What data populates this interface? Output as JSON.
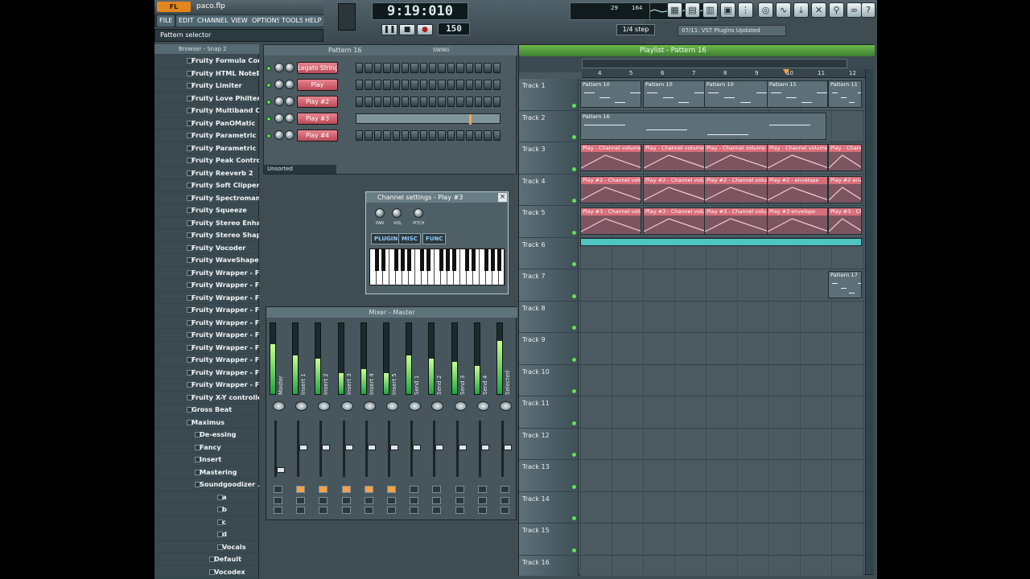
{
  "app": {
    "logo": "FL STUDIO",
    "project": "paco.flp"
  },
  "menu": [
    "FILE",
    "EDIT",
    "CHANNELS",
    "VIEW",
    "OPTIONS",
    "TOOLS",
    "HELP"
  ],
  "pattern_selector": "Pattern selector",
  "transport": {
    "time": "9:19:010",
    "tempo": "150",
    "play": "▶",
    "stop": "■",
    "record": "●",
    "pause": "❚❚",
    "step": "1/4 step",
    "hint": "07/11: VST Plugins Updated",
    "cpu": "29",
    "poly": "164"
  },
  "browser": {
    "title": "Browser - Snap 2",
    "items": [
      {
        "label": "Fruity Formula Con...",
        "indent": 0
      },
      {
        "label": "Fruity HTML NoteB...",
        "indent": 0
      },
      {
        "label": "Fruity Limiter",
        "indent": 0
      },
      {
        "label": "Fruity Love Philter",
        "indent": 0
      },
      {
        "label": "Fruity Multiband Co...",
        "indent": 0
      },
      {
        "label": "Fruity PanOMatic",
        "indent": 0
      },
      {
        "label": "Fruity Parametric EQ",
        "indent": 0
      },
      {
        "label": "Fruity Parametric E...",
        "indent": 0
      },
      {
        "label": "Fruity Peak Control...",
        "indent": 0
      },
      {
        "label": "Fruity Reeverb 2",
        "indent": 0
      },
      {
        "label": "Fruity Soft Clipper",
        "indent": 0
      },
      {
        "label": "Fruity Spectroman",
        "indent": 0
      },
      {
        "label": "Fruity Squeeze",
        "indent": 0
      },
      {
        "label": "Fruity Stereo Enha...",
        "indent": 0
      },
      {
        "label": "Fruity Stereo Shaper",
        "indent": 0
      },
      {
        "label": "Fruity Vocoder",
        "indent": 0
      },
      {
        "label": "Fruity WaveShaper",
        "indent": 0
      },
      {
        "label": "Fruity Wrapper - Fr...",
        "indent": 0
      },
      {
        "label": "Fruity Wrapper - Fr...",
        "indent": 0
      },
      {
        "label": "Fruity Wrapper - Fr...",
        "indent": 0
      },
      {
        "label": "Fruity Wrapper - Fr...",
        "indent": 0
      },
      {
        "label": "Fruity Wrapper - Fr...",
        "indent": 0
      },
      {
        "label": "Fruity Wrapper - Fr...",
        "indent": 0
      },
      {
        "label": "Fruity Wrapper - Fr...",
        "indent": 0
      },
      {
        "label": "Fruity Wrapper - Fr...",
        "indent": 0
      },
      {
        "label": "Fruity Wrapper - Fr...",
        "indent": 0
      },
      {
        "label": "Fruity Wrapper - Fr...",
        "indent": 0
      },
      {
        "label": "Fruity X-Y controller",
        "indent": 0
      },
      {
        "label": "Gross Beat",
        "indent": 0
      },
      {
        "label": "Maximus",
        "indent": 0
      },
      {
        "label": "De-essing",
        "indent": 1
      },
      {
        "label": "Fancy",
        "indent": 1
      },
      {
        "label": "Insert",
        "indent": 1
      },
      {
        "label": "Mastering",
        "indent": 1
      },
      {
        "label": "Soundgoodizer ...",
        "indent": 1
      },
      {
        "label": "a",
        "indent": 2
      },
      {
        "label": "b",
        "indent": 2
      },
      {
        "label": "c",
        "indent": 2
      },
      {
        "label": "d",
        "indent": 2
      },
      {
        "label": "Vocals",
        "indent": 2
      },
      {
        "label": "Default",
        "indent": 3
      },
      {
        "label": "Vocodex",
        "indent": 3
      }
    ]
  },
  "stepseq": {
    "title": "Pattern 16",
    "swing": "SWING",
    "filter": "Unsorted",
    "channels": [
      "Legato Strings",
      "Play",
      "Play #2",
      "Play #3",
      "Play #4"
    ]
  },
  "channel_settings": {
    "title": "Channel settings - Play #3",
    "tabs": [
      "PLUGIN",
      "MISC",
      "FUNC"
    ],
    "knobs": [
      "PAN",
      "VOL",
      "PITCH"
    ]
  },
  "mixer": {
    "title": "Mixer - Master",
    "tracks": [
      "Master",
      "Insert 1",
      "Insert 2",
      "Insert 3",
      "Insert 4",
      "Insert 5",
      "Send 1",
      "Send 2",
      "Send 3",
      "Send 4",
      "Selected"
    ]
  },
  "playlist": {
    "title": "Playlist - Pattern 16",
    "ruler": [
      "4",
      "5",
      "6",
      "7",
      "8",
      "9",
      "10",
      "11",
      "12"
    ],
    "tracks": [
      "Track 1",
      "Track 2",
      "Track 3",
      "Track 4",
      "Track 5",
      "Track 6",
      "Track 7",
      "Track 8",
      "Track 9",
      "Track 10",
      "Track 11",
      "Track 12",
      "Track 13",
      "Track 14",
      "Track 15",
      "Track 16"
    ],
    "clips": {
      "t1": [
        "Pattern 10",
        "Pattern 10",
        "Pattern 10",
        "Pattern 15",
        "Pattern 11"
      ],
      "t2": [
        "Pattern 16"
      ],
      "t3": [
        "Play - Channel volume en...",
        "Play - Channel volume en...",
        "Play - Channel volume #3...",
        "Play - Channel volume en...",
        "Play - Channel..."
      ],
      "t4": [
        "Play #2 - Channel volu...",
        "Play #2 - Channel volu...",
        "Play #2 - Channel volum...",
        "Play #2 - envelope",
        "Play #2 envel"
      ],
      "t5": [
        "Play #3 - Channel volu...",
        "Play #3 - Channel volu...",
        "Play #3 - Channel volu...",
        "Play #3 envelope",
        "Play #3 - Cha"
      ],
      "t7": [
        "Pattern 17"
      ]
    }
  },
  "colors": {
    "accent": "#f4a14a",
    "led": "#56e04a",
    "playlist_head": "#5cab45",
    "auto_clip": "#d86e7a"
  }
}
